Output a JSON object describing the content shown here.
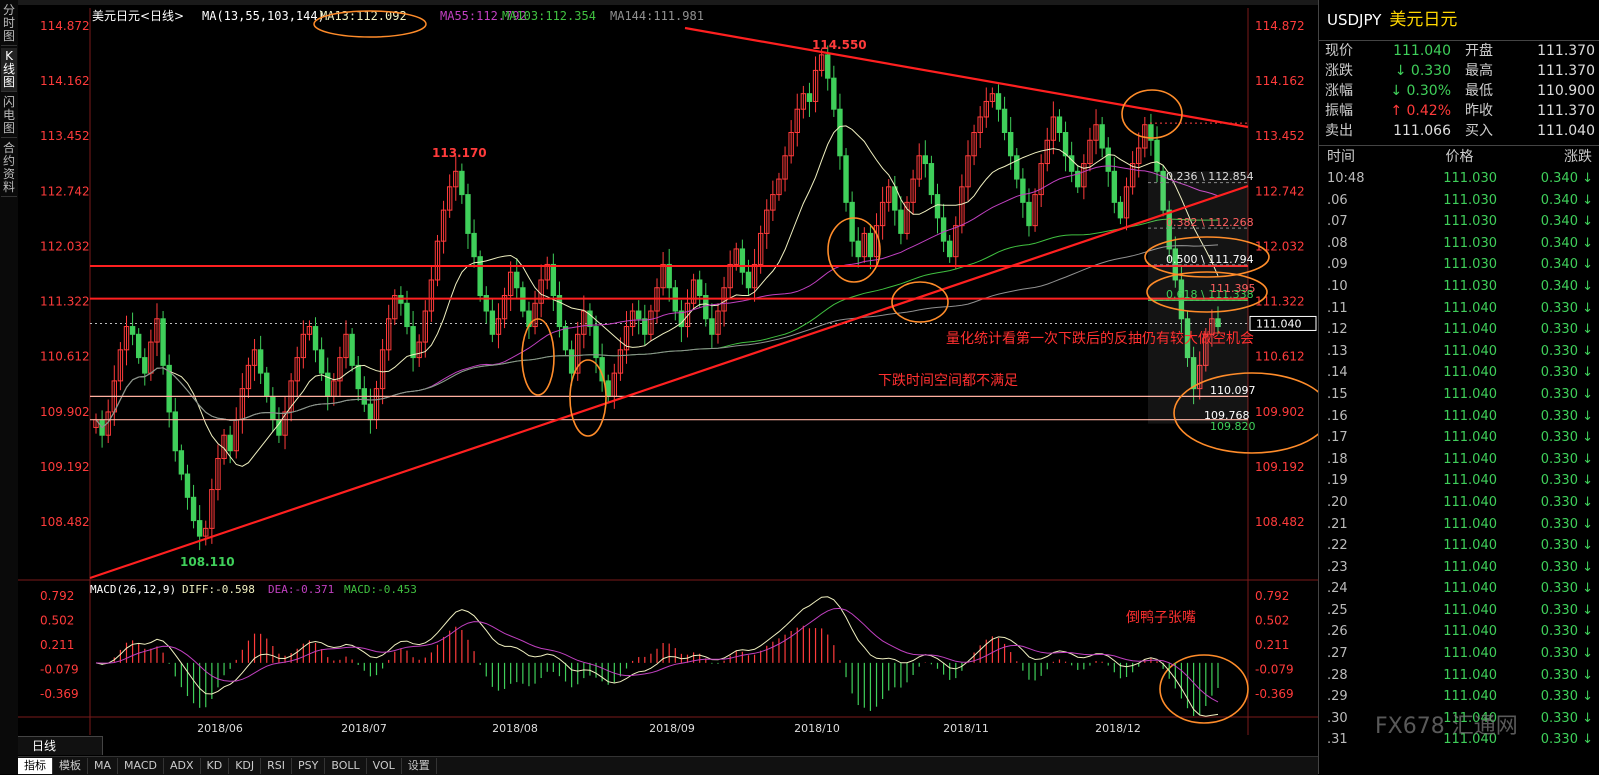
{
  "left_tabs": [
    "分时图",
    "K线图",
    "闪电图",
    "合约资料"
  ],
  "chart_data": {
    "type": "candlestick",
    "title": "美元日元<日线>",
    "ma_legend": {
      "label": "MA(13,55,103,144)",
      "ma13": "MA13:112.092",
      "ma55": "MA55:112.792",
      "ma103": "MA103:112.354",
      "ma144": "MA144:111.981"
    },
    "y_ticks": [
      "114.872",
      "114.162",
      "113.452",
      "112.742",
      "112.032",
      "111.322",
      "110.612",
      "109.902",
      "109.192",
      "108.482"
    ],
    "ylim": [
      108.0,
      115.0
    ],
    "x_ticks": [
      "2018/06",
      "2018/07",
      "2018/08",
      "2018/09",
      "2018/10",
      "2018/11",
      "2018/12"
    ],
    "current_price_label": "111.040",
    "high_labels": [
      {
        "text": "114.550",
        "value": 114.55
      },
      {
        "text": "113.170",
        "value": 113.17
      },
      {
        "text": "108.110",
        "value": 108.11
      }
    ],
    "fib_labels": [
      "0.236 \\ 112.854",
      "0.382 \\ 112.268",
      "0.500 \\ 111.794",
      "0.618 \\ 111.338",
      "111.395"
    ],
    "low_labels": [
      "110.097",
      "109.768",
      "109.820"
    ],
    "horizontal_levels": [
      111.78,
      111.36,
      110.1,
      109.8
    ],
    "closes": [
      109.8,
      109.6,
      109.9,
      110.3,
      110.7,
      111.0,
      110.9,
      110.6,
      110.4,
      110.8,
      111.1,
      110.5,
      109.9,
      109.4,
      109.1,
      108.8,
      108.5,
      108.3,
      108.4,
      108.9,
      109.3,
      109.6,
      109.4,
      109.8,
      110.2,
      110.5,
      110.7,
      110.4,
      110.1,
      109.8,
      109.6,
      109.9,
      110.3,
      110.6,
      110.9,
      111.0,
      110.7,
      110.4,
      110.1,
      110.3,
      110.6,
      110.9,
      110.5,
      110.2,
      110.0,
      109.8,
      110.2,
      110.7,
      111.1,
      111.4,
      111.3,
      111.0,
      110.6,
      110.8,
      111.2,
      111.6,
      112.1,
      112.5,
      112.8,
      113.0,
      112.7,
      112.2,
      111.9,
      111.4,
      111.2,
      110.9,
      111.1,
      111.4,
      111.7,
      111.5,
      111.2,
      111.0,
      111.3,
      111.6,
      111.8,
      111.4,
      111.0,
      110.7,
      110.4,
      110.9,
      111.2,
      111.0,
      110.6,
      110.3,
      110.1,
      110.4,
      110.7,
      111.0,
      111.2,
      111.1,
      110.9,
      111.2,
      111.5,
      111.8,
      111.5,
      111.2,
      111.0,
      111.3,
      111.6,
      111.4,
      111.1,
      110.9,
      111.2,
      111.5,
      111.8,
      112.0,
      111.7,
      111.5,
      111.8,
      112.2,
      112.5,
      112.7,
      112.9,
      113.2,
      113.5,
      113.8,
      114.0,
      113.9,
      114.3,
      114.5,
      114.2,
      113.8,
      113.2,
      112.6,
      112.1,
      111.9,
      112.2,
      111.9,
      112.3,
      112.6,
      112.8,
      112.5,
      112.2,
      112.6,
      112.9,
      113.2,
      113.1,
      112.7,
      112.4,
      112.1,
      111.9,
      112.3,
      112.8,
      113.2,
      113.5,
      113.7,
      113.9,
      114.0,
      113.8,
      113.5,
      113.2,
      112.9,
      112.6,
      112.3,
      112.7,
      113.1,
      113.4,
      113.7,
      113.5,
      113.2,
      113.0,
      112.8,
      113.1,
      113.4,
      113.6,
      113.3,
      113.0,
      112.6,
      112.4,
      112.8,
      113.1,
      113.3,
      113.6,
      113.4,
      113.0,
      112.5,
      112.0,
      111.6,
      111.1,
      110.6,
      110.2,
      110.5,
      110.9,
      111.1,
      111.0
    ]
  },
  "annotations": {
    "quant_note": "量化统计看第一次下跌后的反抽仍有较大做空机会",
    "not_satisfied": "下跌时间空间都不满足",
    "macd_note": "倒鸭子张嘴"
  },
  "macd": {
    "label": "MACD(26,12,9)",
    "diff": "DIFF:-0.598",
    "dea": "DEA:-0.371",
    "macd": "MACD:-0.453",
    "y_ticks": [
      "0.792",
      "0.502",
      "0.211",
      "-0.079",
      "-0.369"
    ],
    "ylim": [
      -0.55,
      0.9
    ]
  },
  "period_label": "日线",
  "bottom_tabs": [
    "指标",
    "模板",
    "MA",
    "MACD",
    "ADX",
    "KD",
    "KDJ",
    "RSI",
    "PSY",
    "BOLL",
    "VOL",
    "设置"
  ],
  "quote": {
    "symbol": "USDJPY",
    "name": "美元日元",
    "rows": [
      {
        "l1": "现价",
        "v1": "111.040",
        "c1": "green",
        "l2": "开盘",
        "v2": "111.370",
        "c2": "white"
      },
      {
        "l1": "涨跌",
        "v1": "↓ 0.330",
        "c1": "green",
        "l2": "最高",
        "v2": "111.370",
        "c2": "white"
      },
      {
        "l1": "涨幅",
        "v1": "↓ 0.30%",
        "c1": "green",
        "l2": "最低",
        "v2": "110.900",
        "c2": "white"
      },
      {
        "l1": "振幅",
        "v1": "↑ 0.42%",
        "c1": "red",
        "l2": "昨收",
        "v2": "111.370",
        "c2": "white"
      },
      {
        "l1": "卖出",
        "v1": "111.066",
        "c1": "white",
        "l2": "买入",
        "v2": "111.040",
        "c2": "white"
      }
    ],
    "tick_headers": [
      "时间",
      "价格",
      "涨跌"
    ],
    "ticks": [
      {
        "t": "10:48",
        "p": "111.030",
        "c": "0.340 ↓"
      },
      {
        "t": ".06",
        "p": "111.030",
        "c": "0.340 ↓"
      },
      {
        "t": ".07",
        "p": "111.030",
        "c": "0.340 ↓"
      },
      {
        "t": ".08",
        "p": "111.030",
        "c": "0.340 ↓"
      },
      {
        "t": ".09",
        "p": "111.030",
        "c": "0.340 ↓"
      },
      {
        "t": ".10",
        "p": "111.030",
        "c": "0.340 ↓"
      },
      {
        "t": ".11",
        "p": "111.040",
        "c": "0.330 ↓"
      },
      {
        "t": ".12",
        "p": "111.040",
        "c": "0.330 ↓"
      },
      {
        "t": ".13",
        "p": "111.040",
        "c": "0.330 ↓"
      },
      {
        "t": ".14",
        "p": "111.040",
        "c": "0.330 ↓"
      },
      {
        "t": ".15",
        "p": "111.040",
        "c": "0.330 ↓"
      },
      {
        "t": ".16",
        "p": "111.040",
        "c": "0.330 ↓"
      },
      {
        "t": ".17",
        "p": "111.040",
        "c": "0.330 ↓"
      },
      {
        "t": ".18",
        "p": "111.040",
        "c": "0.330 ↓"
      },
      {
        "t": ".19",
        "p": "111.040",
        "c": "0.330 ↓"
      },
      {
        "t": ".20",
        "p": "111.040",
        "c": "0.330 ↓"
      },
      {
        "t": ".21",
        "p": "111.040",
        "c": "0.330 ↓"
      },
      {
        "t": ".22",
        "p": "111.040",
        "c": "0.330 ↓"
      },
      {
        "t": ".23",
        "p": "111.040",
        "c": "0.330 ↓"
      },
      {
        "t": ".24",
        "p": "111.040",
        "c": "0.330 ↓"
      },
      {
        "t": ".25",
        "p": "111.040",
        "c": "0.330 ↓"
      },
      {
        "t": ".26",
        "p": "111.040",
        "c": "0.330 ↓"
      },
      {
        "t": ".27",
        "p": "111.040",
        "c": "0.330 ↓"
      },
      {
        "t": ".28",
        "p": "111.040",
        "c": "0.330 ↓"
      },
      {
        "t": ".29",
        "p": "111.040",
        "c": "0.330 ↓"
      },
      {
        "t": ".30",
        "p": "111.040",
        "c": "0.330 ↓"
      },
      {
        "t": ".31",
        "p": "111.040",
        "c": "0.330 ↓"
      }
    ]
  },
  "watermark": "FX678 汇通网",
  "colors": {
    "up": "#ff3b3b",
    "down": "#3fcf5a",
    "ma13": "#f0f0c0",
    "ma55": "#c040c0",
    "ma103": "#40c040",
    "ma144": "#909090",
    "trendline": "#ff2020",
    "annotation": "#ff3030",
    "ellipse": "#ff8c2a"
  }
}
